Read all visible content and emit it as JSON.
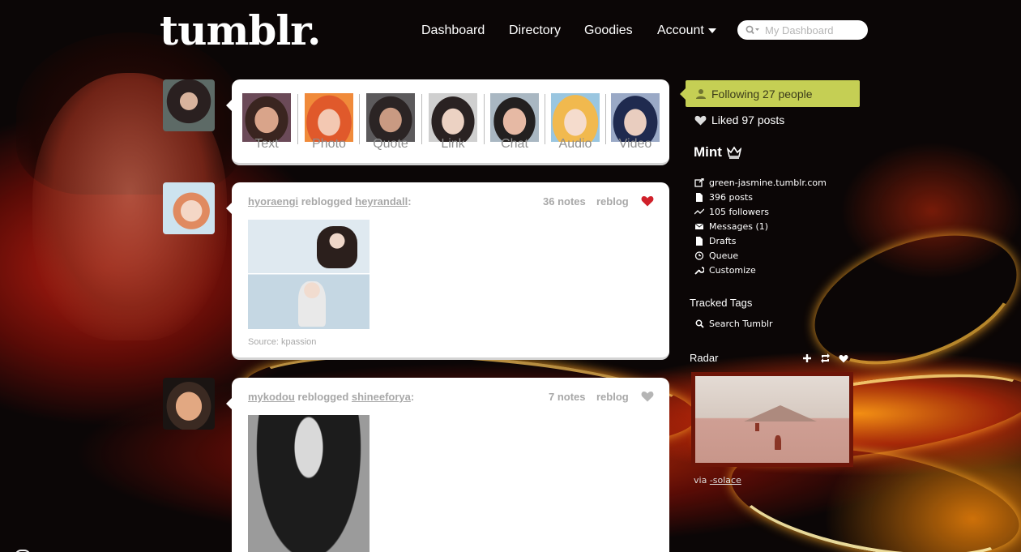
{
  "header": {
    "logo": "tumblr.",
    "nav": {
      "dashboard": "Dashboard",
      "directory": "Directory",
      "goodies": "Goodies",
      "account": "Account"
    },
    "search_placeholder": "My Dashboard"
  },
  "post_types": [
    {
      "label": "Text"
    },
    {
      "label": "Photo"
    },
    {
      "label": "Quote"
    },
    {
      "label": "Link"
    },
    {
      "label": "Chat"
    },
    {
      "label": "Audio"
    },
    {
      "label": "Video"
    }
  ],
  "posts": [
    {
      "user": "hyoraengi",
      "verb": "reblogged",
      "source_user": "heyrandall",
      "notes": "36 notes",
      "reblog": "reblog",
      "liked": true,
      "source": "Source: kpassion"
    },
    {
      "user": "mykodou",
      "verb": "reblogged",
      "source_user": "shineeforya",
      "notes": "7 notes",
      "reblog": "reblog",
      "liked": false
    }
  ],
  "sidebar": {
    "following": "Following 27 people",
    "liked": "Liked 97 posts",
    "blog_name": "Mint",
    "blog_menu": [
      {
        "label": "green-jasmine.tumblr.com",
        "icon": "external-link-icon"
      },
      {
        "label": "396 posts",
        "icon": "document-icon"
      },
      {
        "label": "105 followers",
        "icon": "activity-icon"
      },
      {
        "label": "Messages (1)",
        "icon": "envelope-icon"
      },
      {
        "label": "Drafts",
        "icon": "document-icon"
      },
      {
        "label": "Queue",
        "icon": "clock-icon"
      },
      {
        "label": "Customize",
        "icon": "wrench-icon"
      }
    ],
    "tracked_tags_title": "Tracked Tags",
    "search_tumblr": "Search Tumblr",
    "radar_title": "Radar",
    "radar_via": "via",
    "radar_via_user": "-solace"
  },
  "colors": {
    "following_bg": "#c5cf54",
    "liked_heart": "#d0202a",
    "muted_text": "#a8a8a8"
  }
}
